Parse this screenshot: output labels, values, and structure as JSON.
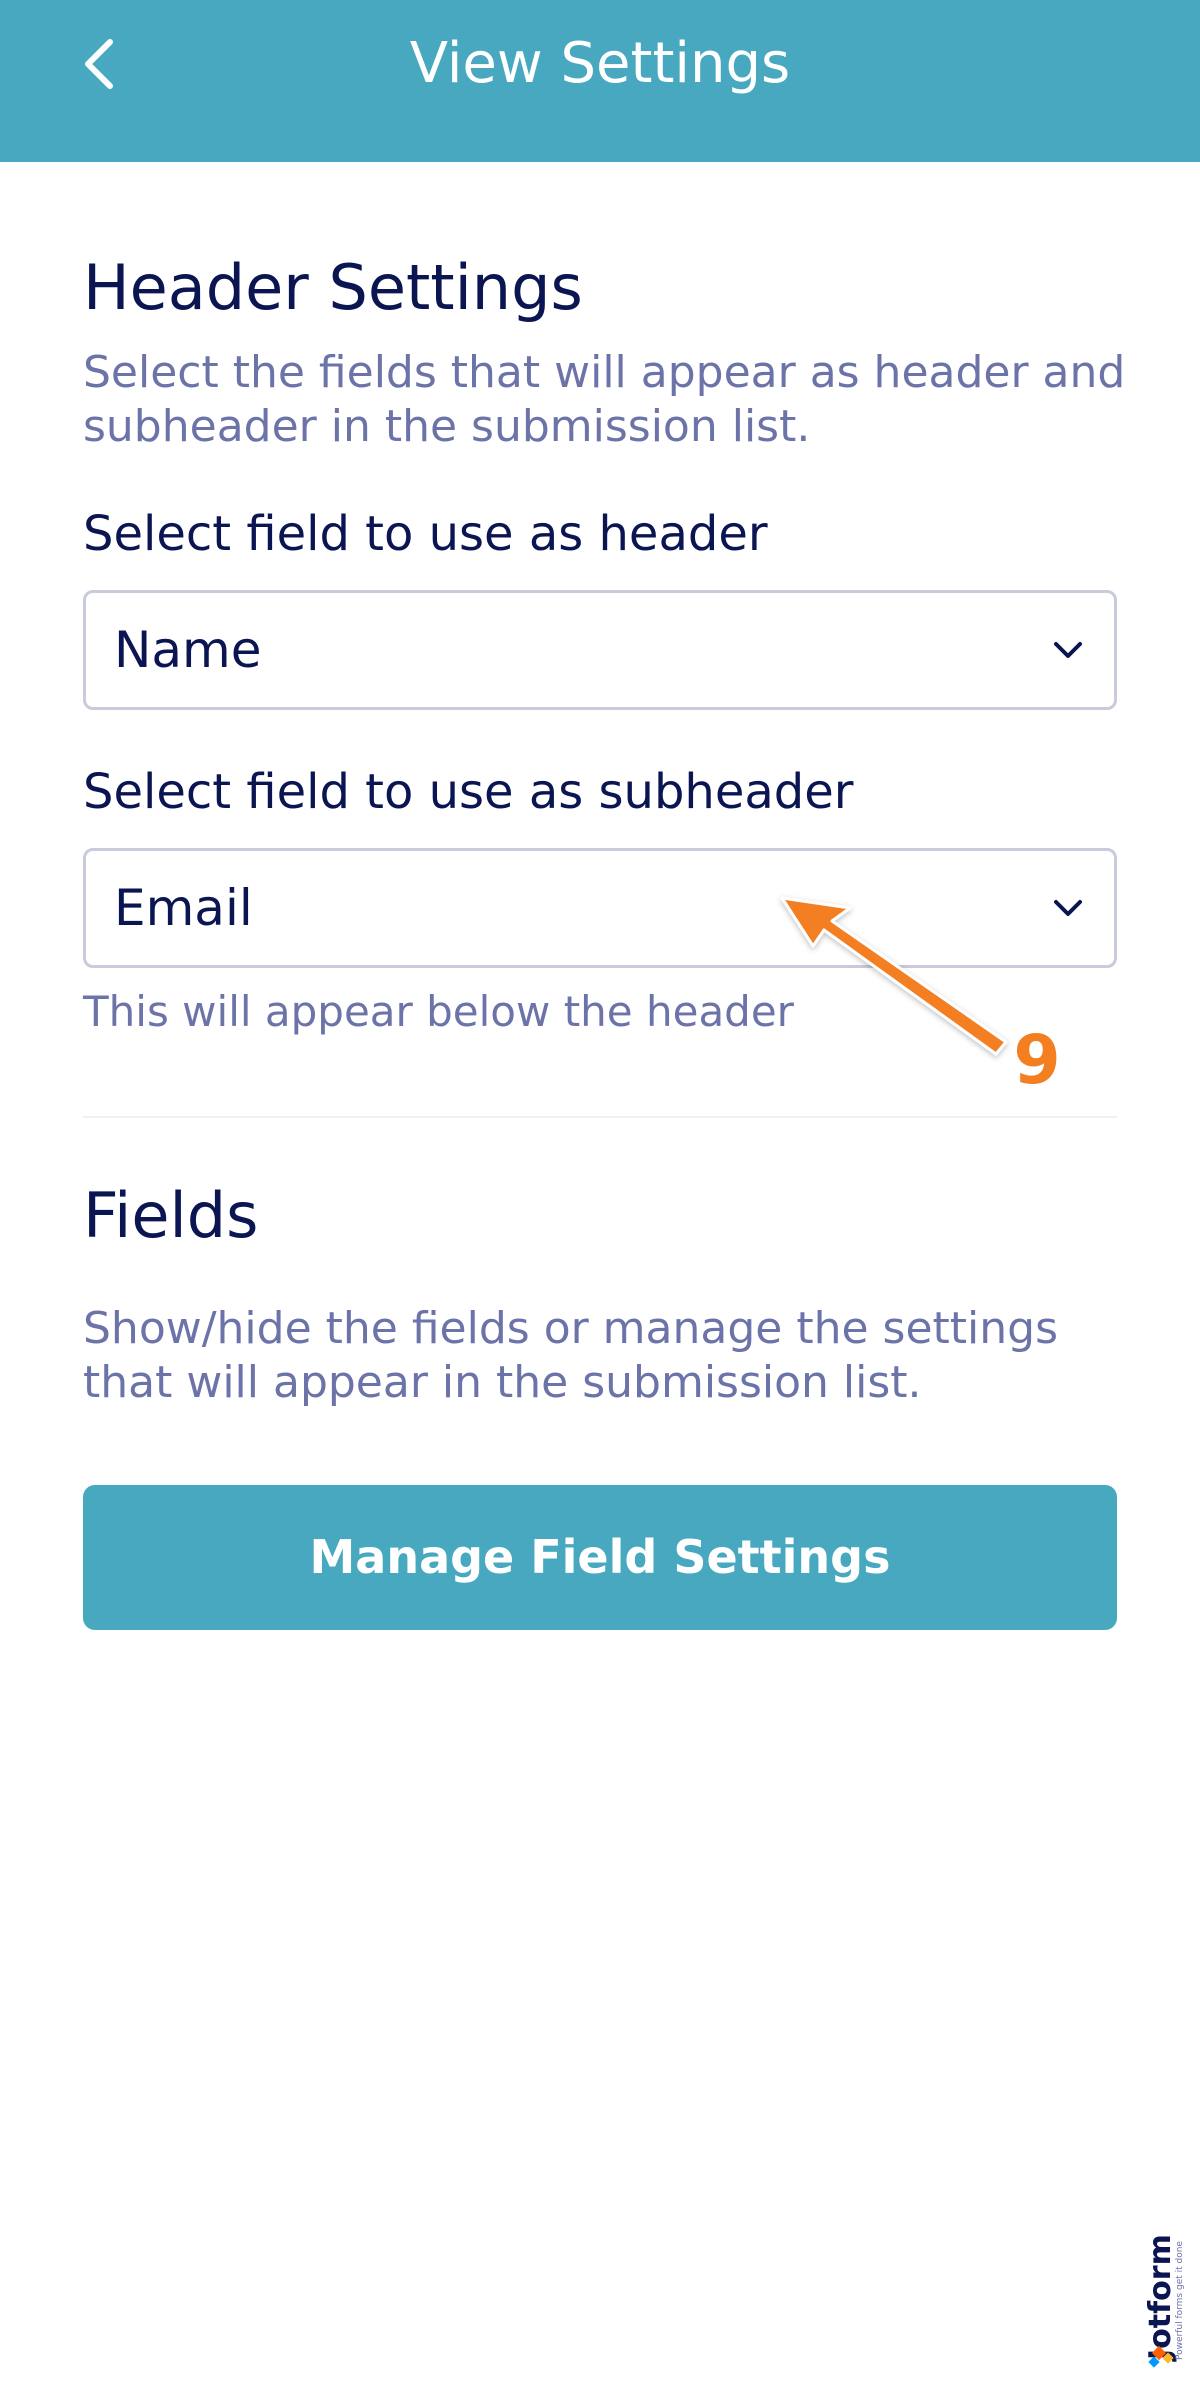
{
  "appbar": {
    "title": "View Settings",
    "back_icon": "chevron-left-icon",
    "background": "#47a8bf"
  },
  "header_settings": {
    "title": "Header Settings",
    "description": "Select the fields that will appear as header and subheader in the submission list.",
    "header_field": {
      "label": "Select field to use as header",
      "value": "Name"
    },
    "subheader_field": {
      "label": "Select field to use as subheader",
      "value": "Email",
      "hint": "This will appear below the header"
    }
  },
  "fields_section": {
    "title": "Fields",
    "description": "Show/hide the fields or manage the settings that will appear in the submission list.",
    "button_label": "Manage Field Settings"
  },
  "annotation": {
    "step_number": "9",
    "color": "#f47f20"
  },
  "watermark": {
    "brand": "Jotform",
    "tagline": "Powerful forms get it done"
  },
  "colors": {
    "accent": "#47a8bf",
    "text_primary": "#0a1551",
    "text_secondary": "#6c73a8",
    "border": "#c8cbdc"
  }
}
